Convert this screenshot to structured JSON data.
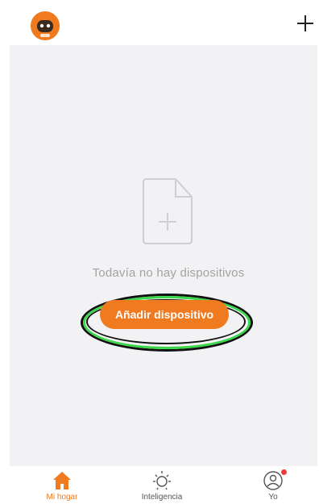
{
  "header": {
    "avatar_icon": "robot-avatar-icon",
    "add_icon": "plus-icon"
  },
  "main": {
    "empty_icon": "document-plus-icon",
    "empty_text": "Todavía no hay dispositivos",
    "add_device_label": "Añadir dispositivo"
  },
  "tabbar": {
    "tabs": [
      {
        "label": "Mi hogar",
        "icon": "home-icon",
        "active": true
      },
      {
        "label": "Inteligencia",
        "icon": "sun-icon",
        "active": false
      },
      {
        "label": "Yo",
        "icon": "profile-icon",
        "active": false,
        "badge": true
      }
    ]
  },
  "colors": {
    "accent": "#f07a1f",
    "background": "#f2f2f4",
    "highlight_ring": "#3cd64a",
    "badge": "#f23b3b"
  }
}
